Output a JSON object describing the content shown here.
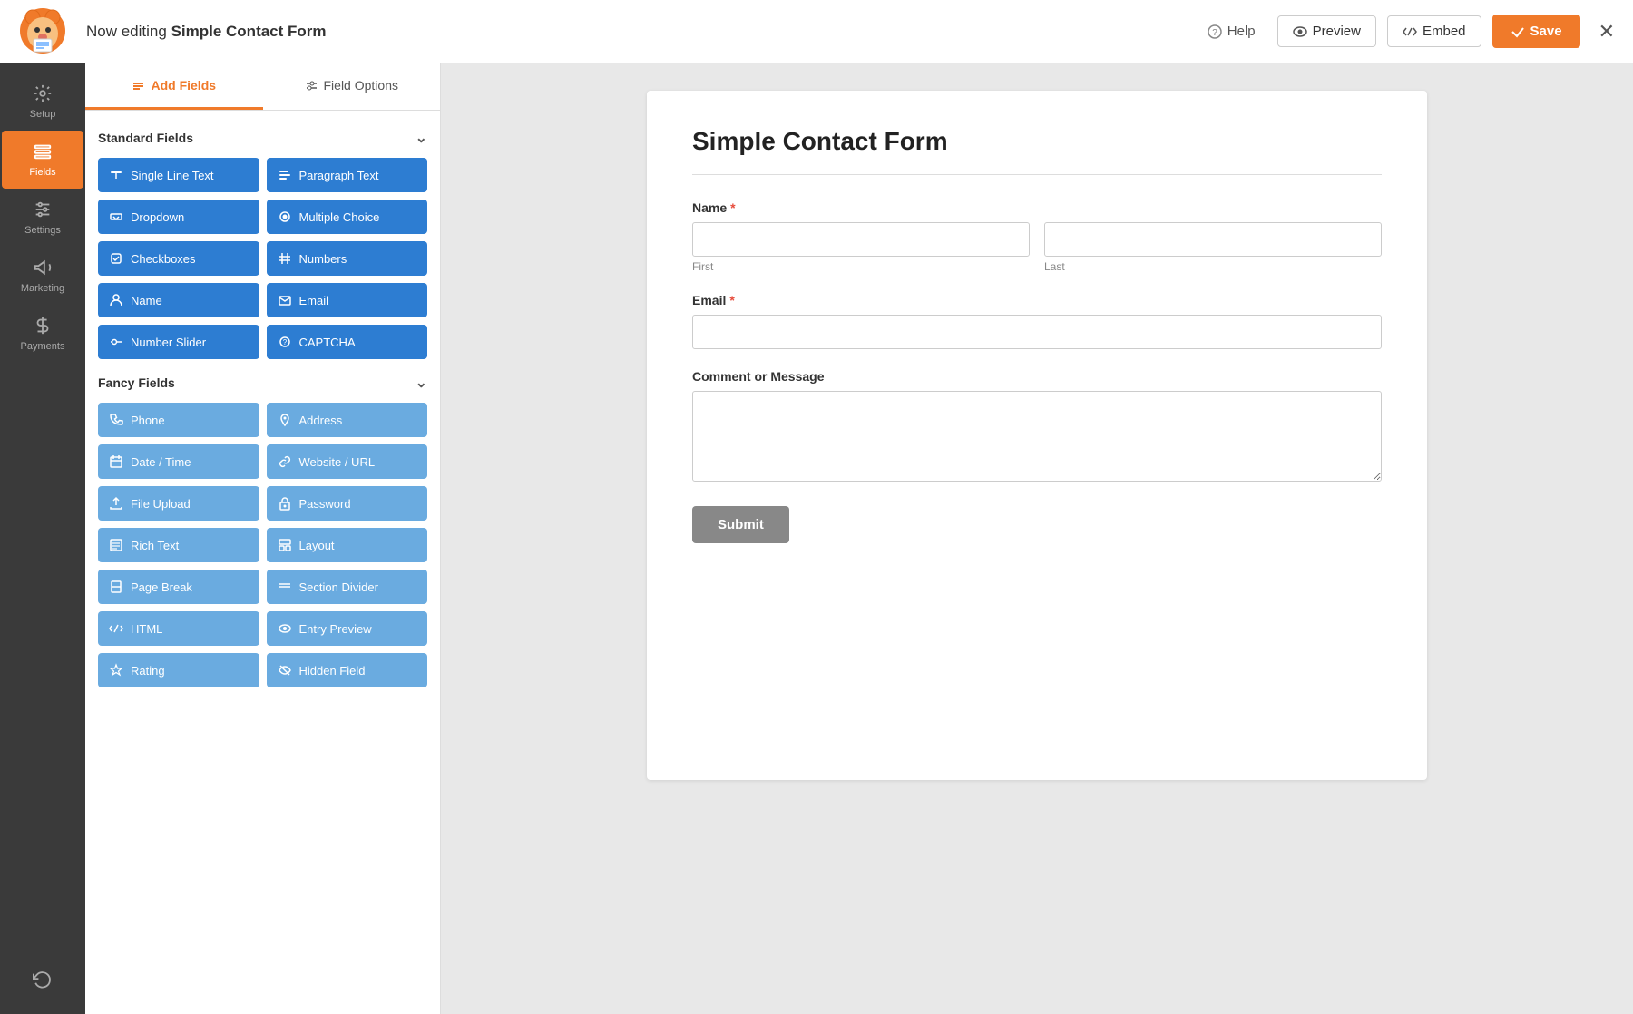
{
  "topbar": {
    "title_prefix": "Now editing ",
    "title_bold": "Simple Contact Form",
    "help_label": "Help",
    "preview_label": "Preview",
    "embed_label": "Embed",
    "save_label": "Save"
  },
  "icon_sidebar": {
    "items": [
      {
        "id": "setup",
        "label": "Setup",
        "icon": "gear"
      },
      {
        "id": "fields",
        "label": "Fields",
        "icon": "fields",
        "active": true
      },
      {
        "id": "settings",
        "label": "Settings",
        "icon": "sliders"
      },
      {
        "id": "marketing",
        "label": "Marketing",
        "icon": "megaphone"
      },
      {
        "id": "payments",
        "label": "Payments",
        "icon": "dollar"
      }
    ],
    "bottom_items": [
      {
        "id": "undo",
        "label": "",
        "icon": "undo"
      }
    ]
  },
  "panel": {
    "tab_add_fields": "Add Fields",
    "tab_field_options": "Field Options",
    "standard_fields_label": "Standard Fields",
    "fancy_fields_label": "Fancy Fields",
    "standard_fields": [
      {
        "id": "single-line-text",
        "label": "Single Line Text",
        "icon": "text-cursor"
      },
      {
        "id": "paragraph-text",
        "label": "Paragraph Text",
        "icon": "paragraph"
      },
      {
        "id": "dropdown",
        "label": "Dropdown",
        "icon": "dropdown"
      },
      {
        "id": "multiple-choice",
        "label": "Multiple Choice",
        "icon": "radio"
      },
      {
        "id": "checkboxes",
        "label": "Checkboxes",
        "icon": "check"
      },
      {
        "id": "numbers",
        "label": "Numbers",
        "icon": "hash"
      },
      {
        "id": "name",
        "label": "Name",
        "icon": "person"
      },
      {
        "id": "email",
        "label": "Email",
        "icon": "email"
      },
      {
        "id": "number-slider",
        "label": "Number Slider",
        "icon": "slider"
      },
      {
        "id": "captcha",
        "label": "CAPTCHA",
        "icon": "captcha"
      }
    ],
    "fancy_fields": [
      {
        "id": "phone",
        "label": "Phone",
        "icon": "phone"
      },
      {
        "id": "address",
        "label": "Address",
        "icon": "pin"
      },
      {
        "id": "date-time",
        "label": "Date / Time",
        "icon": "calendar"
      },
      {
        "id": "website-url",
        "label": "Website / URL",
        "icon": "link"
      },
      {
        "id": "file-upload",
        "label": "File Upload",
        "icon": "upload"
      },
      {
        "id": "password",
        "label": "Password",
        "icon": "lock"
      },
      {
        "id": "rich-text",
        "label": "Rich Text",
        "icon": "richtext"
      },
      {
        "id": "layout",
        "label": "Layout",
        "icon": "layout"
      },
      {
        "id": "page-break",
        "label": "Page Break",
        "icon": "pagebreak"
      },
      {
        "id": "section-divider",
        "label": "Section Divider",
        "icon": "divider"
      },
      {
        "id": "html",
        "label": "HTML",
        "icon": "html"
      },
      {
        "id": "entry-preview",
        "label": "Entry Preview",
        "icon": "preview"
      },
      {
        "id": "rating",
        "label": "Rating",
        "icon": "star"
      },
      {
        "id": "hidden-field",
        "label": "Hidden Field",
        "icon": "hidden"
      }
    ]
  },
  "form": {
    "title": "Simple Contact Form",
    "name_label": "Name",
    "name_first_sub": "First",
    "name_last_sub": "Last",
    "email_label": "Email",
    "comment_label": "Comment or Message",
    "submit_label": "Submit"
  }
}
